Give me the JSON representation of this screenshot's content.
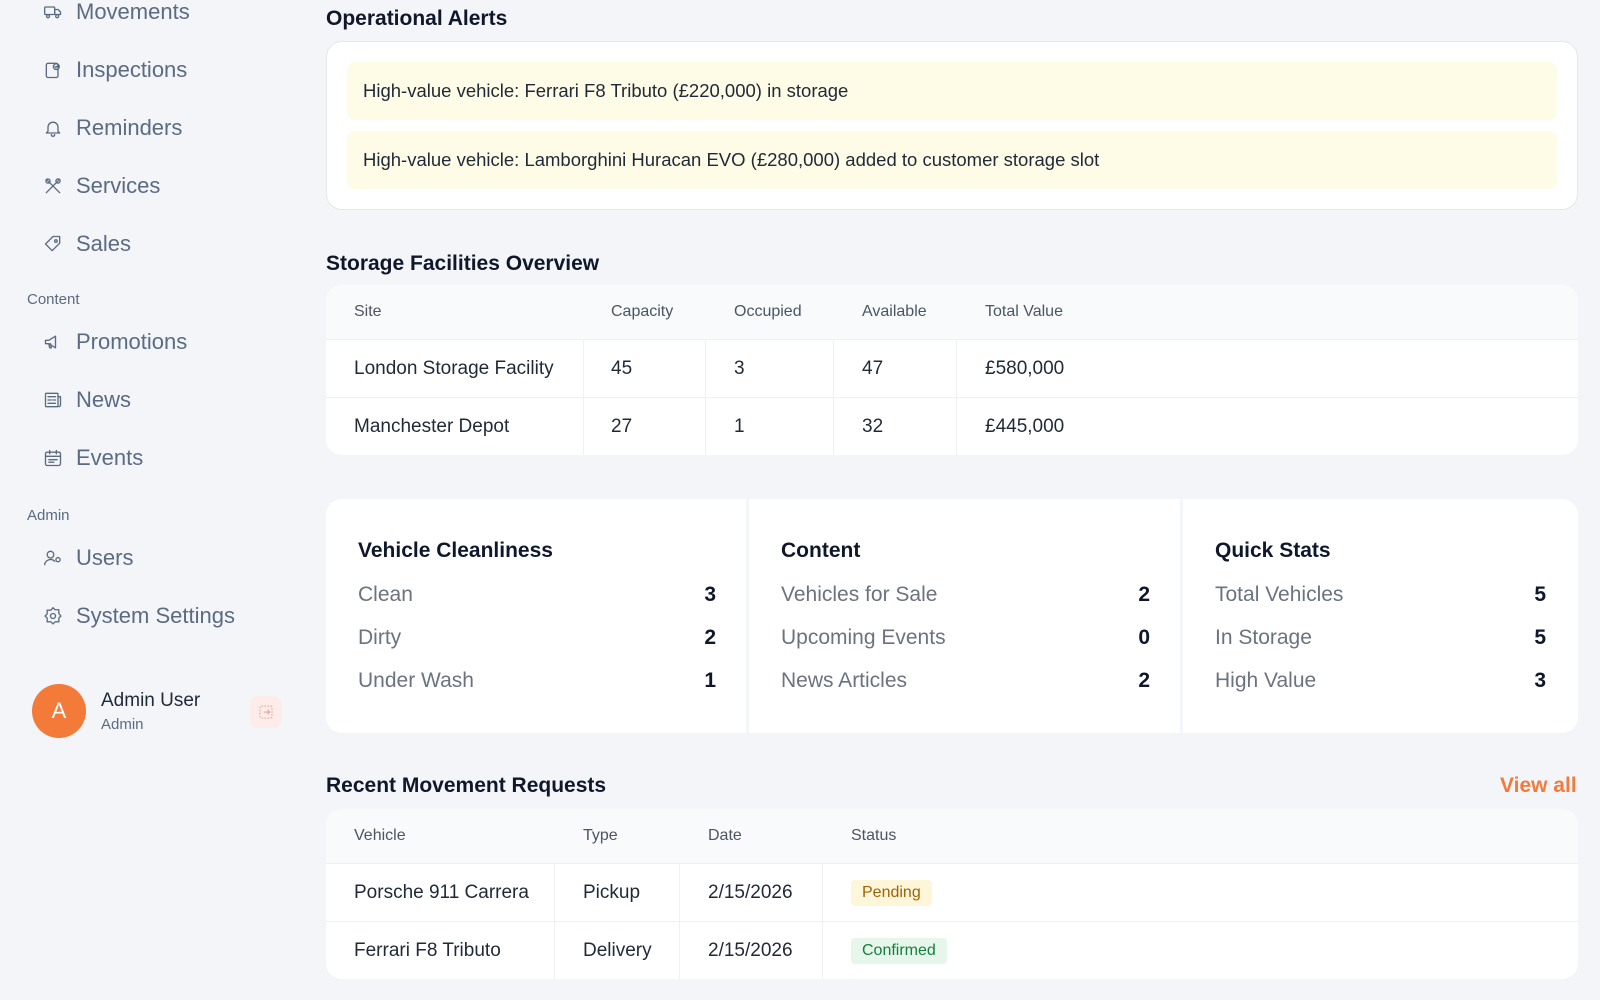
{
  "sidebar": {
    "items": [
      {
        "label": "Movements",
        "icon": "truck-icon"
      },
      {
        "label": "Inspections",
        "icon": "clipboard-check-icon"
      },
      {
        "label": "Reminders",
        "icon": "bell-icon"
      },
      {
        "label": "Services",
        "icon": "tools-icon"
      },
      {
        "label": "Sales",
        "icon": "tag-icon"
      }
    ],
    "section_content": "Content",
    "content_items": [
      {
        "label": "Promotions",
        "icon": "megaphone-icon"
      },
      {
        "label": "News",
        "icon": "newspaper-icon"
      },
      {
        "label": "Events",
        "icon": "calendar-icon"
      }
    ],
    "section_admin": "Admin",
    "admin_items": [
      {
        "label": "Users",
        "icon": "user-cog-icon"
      },
      {
        "label": "System Settings",
        "icon": "settings-icon"
      }
    ],
    "user": {
      "initial": "A",
      "name": "Admin User",
      "role": "Admin"
    }
  },
  "alerts": {
    "title": "Operational Alerts",
    "items": [
      "High-value vehicle: Ferrari F8 Tributo (£220,000) in storage",
      "High-value vehicle: Lamborghini Huracan EVO (£280,000) added to customer storage slot"
    ]
  },
  "storage": {
    "title": "Storage Facilities Overview",
    "headers": [
      "Site",
      "Capacity",
      "Occupied",
      "Available",
      "Total Value"
    ],
    "rows": [
      [
        "London Storage Facility",
        "45",
        "3",
        "47",
        "£580,000"
      ],
      [
        "Manchester Depot",
        "27",
        "1",
        "32",
        "£445,000"
      ]
    ]
  },
  "stats": {
    "cleanliness": {
      "title": "Vehicle Cleanliness",
      "rows": [
        {
          "label": "Clean",
          "value": "3"
        },
        {
          "label": "Dirty",
          "value": "2"
        },
        {
          "label": "Under Wash",
          "value": "1"
        }
      ]
    },
    "content": {
      "title": "Content",
      "rows": [
        {
          "label": "Vehicles for Sale",
          "value": "2"
        },
        {
          "label": "Upcoming Events",
          "value": "0"
        },
        {
          "label": "News Articles",
          "value": "2"
        }
      ]
    },
    "quick": {
      "title": "Quick Stats",
      "rows": [
        {
          "label": "Total Vehicles",
          "value": "5"
        },
        {
          "label": "In Storage",
          "value": "5"
        },
        {
          "label": "High Value",
          "value": "3"
        }
      ]
    }
  },
  "movements": {
    "title": "Recent Movement Requests",
    "view_all": "View all",
    "headers": [
      "Vehicle",
      "Type",
      "Date",
      "Status"
    ],
    "rows": [
      {
        "vehicle": "Porsche 911 Carrera",
        "type": "Pickup",
        "date": "2/15/2026",
        "status": "Pending"
      },
      {
        "vehicle": "Ferrari F8 Tributo",
        "type": "Delivery",
        "date": "2/15/2026",
        "status": "Confirmed"
      }
    ]
  },
  "colors": {
    "accent": "#f47a3a",
    "alert_bg": "#fefbe6",
    "pending": "#a16207",
    "confirmed": "#15803d"
  }
}
